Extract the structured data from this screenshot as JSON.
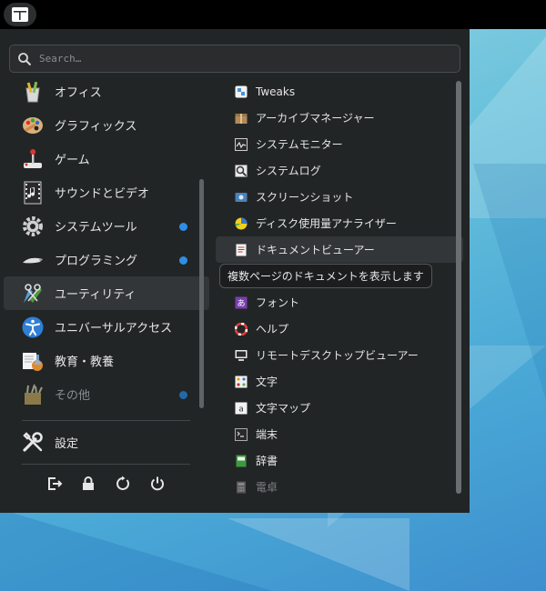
{
  "search": {
    "placeholder": "Search…"
  },
  "categories": [
    {
      "label": "オフィス",
      "icon": "office-icon"
    },
    {
      "label": "グラフィックス",
      "icon": "graphics-icon"
    },
    {
      "label": "ゲーム",
      "icon": "game-icon"
    },
    {
      "label": "サウンドとビデオ",
      "icon": "film-icon"
    },
    {
      "label": "システムツール",
      "icon": "gear-icon",
      "badge": true
    },
    {
      "label": "プログラミング",
      "icon": "programming-icon",
      "badge": true
    },
    {
      "label": "ユーティリティ",
      "icon": "utilities-icon",
      "selected": true
    },
    {
      "label": "ユニバーサルアクセス",
      "icon": "accessibility-icon"
    },
    {
      "label": "教育・教養",
      "icon": "education-icon"
    },
    {
      "label": "その他",
      "icon": "other-icon",
      "badge": true,
      "dim": true
    }
  ],
  "settings": {
    "label": "設定"
  },
  "system_buttons": [
    "logout-icon",
    "lock-icon",
    "restart-icon",
    "power-icon"
  ],
  "apps": [
    {
      "label": "Tweaks",
      "icon": "tweaks-icon"
    },
    {
      "label": "アーカイブマネージャー",
      "icon": "archive-icon"
    },
    {
      "label": "システムモニター",
      "icon": "monitor-icon"
    },
    {
      "label": "システムログ",
      "icon": "log-icon"
    },
    {
      "label": "スクリーンショット",
      "icon": "screenshot-icon"
    },
    {
      "label": "ディスク使用量アナライザー",
      "icon": "disk-usage-icon"
    },
    {
      "label": "ドキュメントビューアー",
      "icon": "document-viewer-icon",
      "selected": true
    },
    {
      "label": "フォント",
      "icon": "font-icon"
    },
    {
      "label": "ヘルプ",
      "icon": "help-icon"
    },
    {
      "label": "リモートデスクトップビューアー",
      "icon": "remote-desktop-icon"
    },
    {
      "label": "文字",
      "icon": "characters-icon"
    },
    {
      "label": "文字マップ",
      "icon": "charmap-icon"
    },
    {
      "label": "端末",
      "icon": "terminal-icon"
    },
    {
      "label": "辞書",
      "icon": "dictionary-icon"
    },
    {
      "label": "電卓",
      "icon": "calculator-icon",
      "dim": true
    }
  ],
  "tooltip": "複数ページのドキュメントを表示します",
  "colors": {
    "accent": "#2e8ee6",
    "panel": "#222526",
    "selection": "#333638"
  }
}
